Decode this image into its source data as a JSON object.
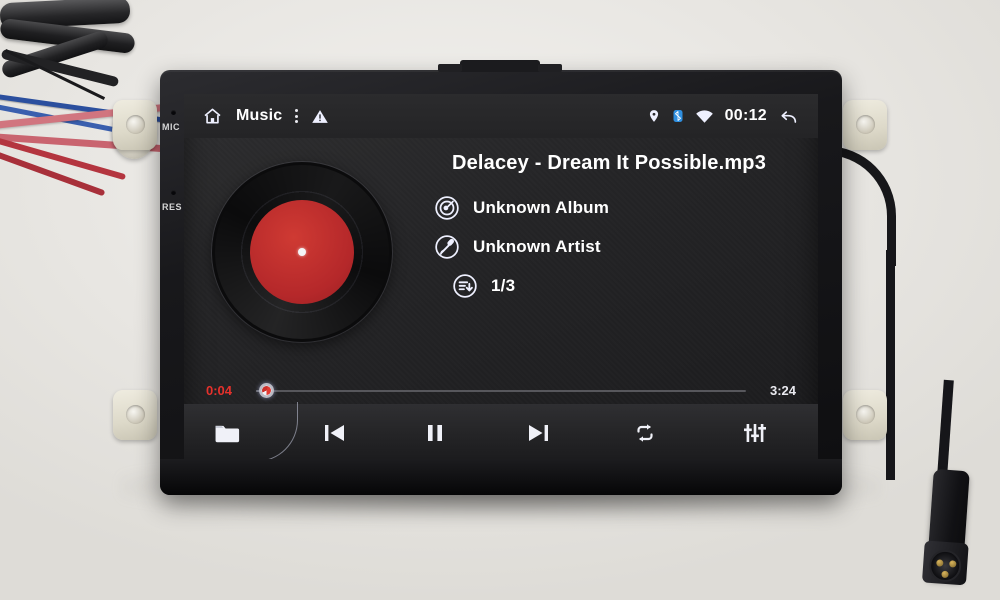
{
  "device": {
    "side_labels": {
      "mic": "MIC",
      "res": "RES"
    }
  },
  "screen": {
    "statusbar": {
      "home_icon": "home-icon",
      "app_title": "Music",
      "overflow_icon": "more-vertical-icon",
      "warning_icon": "warning-triangle-icon",
      "location_icon": "location-pin-icon",
      "bluetooth_icon": "bluetooth-icon",
      "wifi_icon": "wifi-icon",
      "clock": "00:12",
      "back_icon": "back-arrow-icon",
      "bluetooth_color": "#2f8fe0"
    },
    "now_playing": {
      "artwork_icon": "vinyl-record-art",
      "track_title": "Delacey - Dream It Possible.mp3",
      "meta": [
        {
          "icon": "album-disc-icon",
          "label": "Unknown Album"
        },
        {
          "icon": "microphone-icon",
          "label": "Unknown Artist"
        },
        {
          "icon": "playlist-index-icon",
          "label": "1/3"
        }
      ]
    },
    "progress": {
      "current_time": "0:04",
      "total_time": "3:24",
      "percent": 2,
      "current_time_color": "#e6312c"
    },
    "toolbar": {
      "buttons": [
        {
          "name": "folder-button",
          "icon": "folder-icon"
        },
        {
          "name": "previous-button",
          "icon": "skip-previous-icon"
        },
        {
          "name": "playpause-button",
          "icon": "pause-icon"
        },
        {
          "name": "next-button",
          "icon": "skip-next-icon"
        },
        {
          "name": "repeat-button",
          "icon": "repeat-icon"
        },
        {
          "name": "equalizer-button",
          "icon": "equalizer-icon"
        }
      ]
    }
  }
}
